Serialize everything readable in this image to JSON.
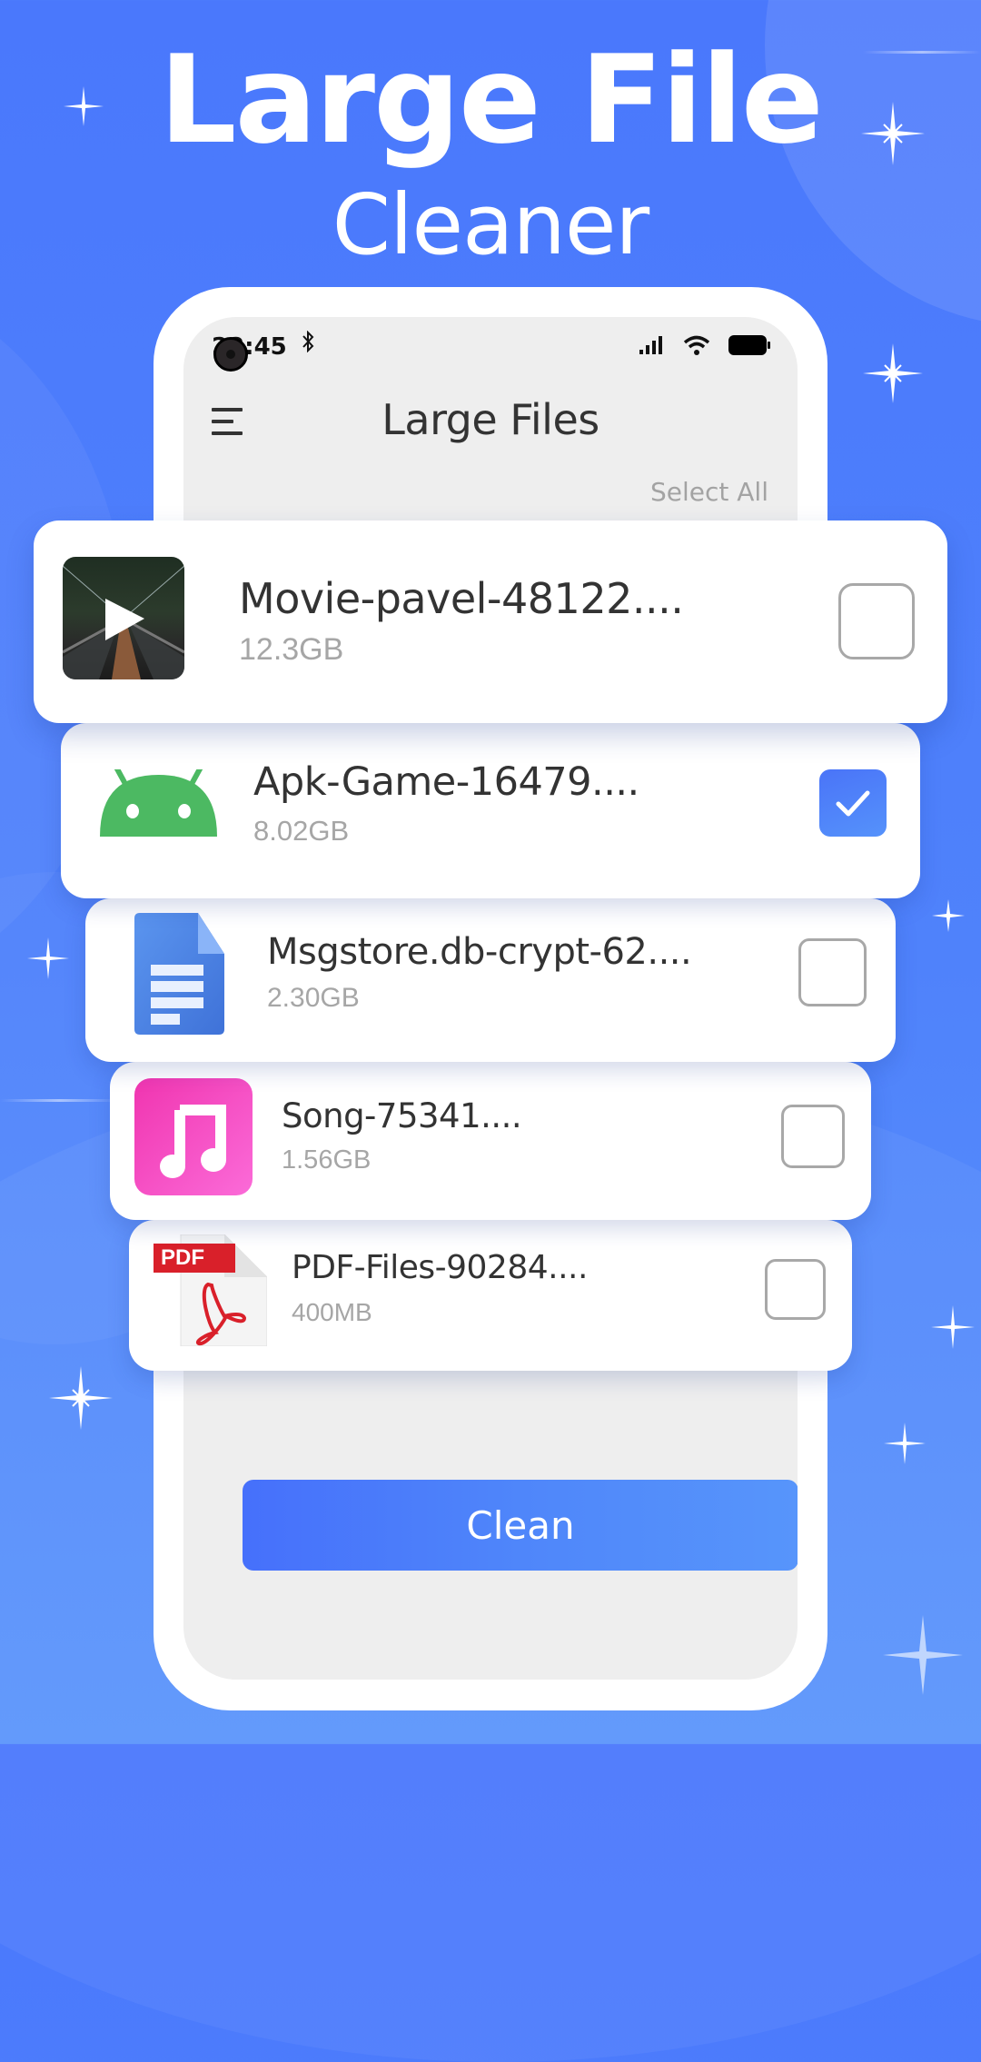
{
  "promo": {
    "title_line1": "Large File",
    "title_line2": "Cleaner"
  },
  "status_bar": {
    "time": "22:45",
    "bluetooth_icon": "bluetooth-icon",
    "signal_icon": "signal-icon",
    "wifi_icon": "wifi-icon",
    "battery_icon": "battery-icon"
  },
  "app_bar": {
    "menu_icon": "menu-icon",
    "title": "Large Files",
    "select_all_label": "Select All"
  },
  "files": [
    {
      "name": "Movie-pavel-48122....",
      "size": "12.3GB",
      "type": "video",
      "icon": "video-thumbnail-icon",
      "checked": false
    },
    {
      "name": "Apk-Game-16479....",
      "size": "8.02GB",
      "type": "apk",
      "icon": "android-icon",
      "checked": true
    },
    {
      "name": "Msgstore.db-crypt-62....",
      "size": "2.30GB",
      "type": "document",
      "icon": "document-icon",
      "checked": false
    },
    {
      "name": "Song-75341....",
      "size": "1.56GB",
      "type": "audio",
      "icon": "music-icon",
      "checked": false
    },
    {
      "name": "PDF-Files-90284....",
      "size": "400MB",
      "type": "pdf",
      "icon": "pdf-icon",
      "pdf_badge": "PDF",
      "checked": false
    }
  ],
  "actions": {
    "clean_label": "Clean"
  },
  "colors": {
    "background": "#4a78fc",
    "accent": "#4a74f8",
    "screen": "#eeeeee",
    "android_green": "#4cb962",
    "music_pink": "#f040b8",
    "pdf_red": "#d9202a",
    "doc_blue": "#4a86e8"
  }
}
